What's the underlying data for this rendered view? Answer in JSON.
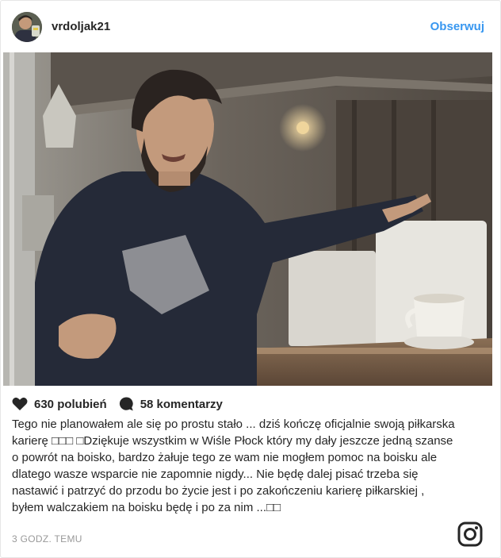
{
  "header": {
    "username": "vrdoljak21",
    "follow_label": "Obserwuj"
  },
  "actions": {
    "likes": "630 polubień",
    "comments": "58 komentarzy"
  },
  "caption": "Tego nie planowałem ale się po prostu stało ... dziś kończę oficjalnie swoją piłkarska karierę □□□ □Dziękuje wszystkim w Wiśle Płock który my dały jeszcze jedną szanse o powrót na boisko, bardzo żałuje tego ze wam nie mogłem pomoc na boisku ale dlatego wasze wsparcie nie zapomnie nigdy... Nie będę dalej pisać trzeba się nastawić i patrzyć do przodu bo życie jest i po zakończeniu karierę piłkarskiej , byłem walczakiem na boisku będę i po za nim ...□□",
  "timestamp": "3 GODZ. TEMU",
  "icons": {
    "like": "heart-icon",
    "comment": "comment-bubble-icon",
    "brand": "instagram-logo-icon"
  },
  "colors": {
    "follow": "#3897f0",
    "text": "#262626",
    "muted": "#999999",
    "border": "#e6e6e6"
  }
}
